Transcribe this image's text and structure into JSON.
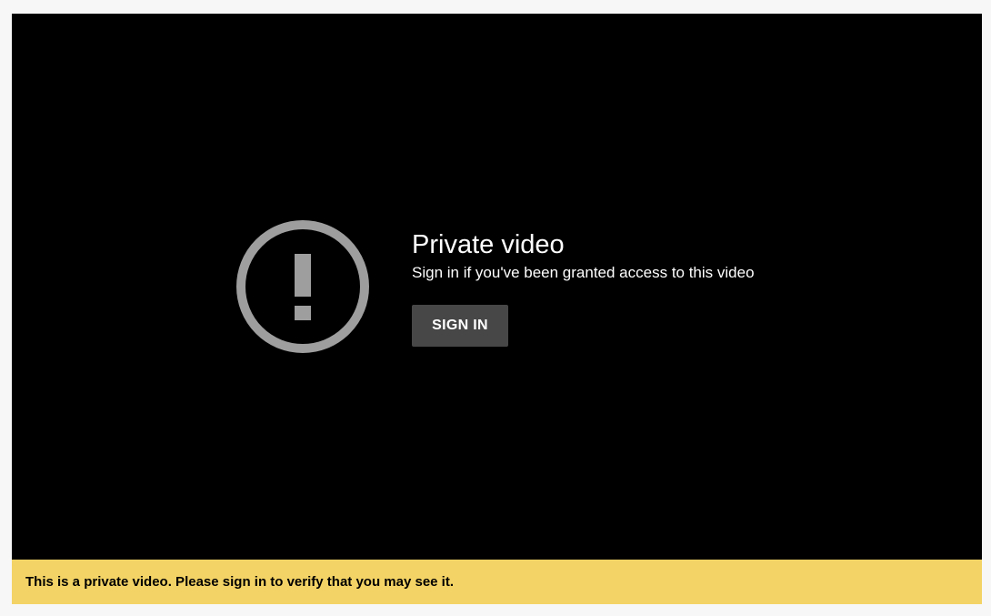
{
  "player": {
    "icon": "exclamation-circle-icon",
    "icon_color": "#9e9e9e",
    "title": "Private video",
    "subtitle": "Sign in if you've been granted access to this video",
    "sign_in_label": "SIGN IN",
    "background_color": "#000000",
    "button_color": "#474747"
  },
  "notice": {
    "text": "This is a private video. Please sign in to verify that you may see it.",
    "background_color": "#f3d365"
  }
}
